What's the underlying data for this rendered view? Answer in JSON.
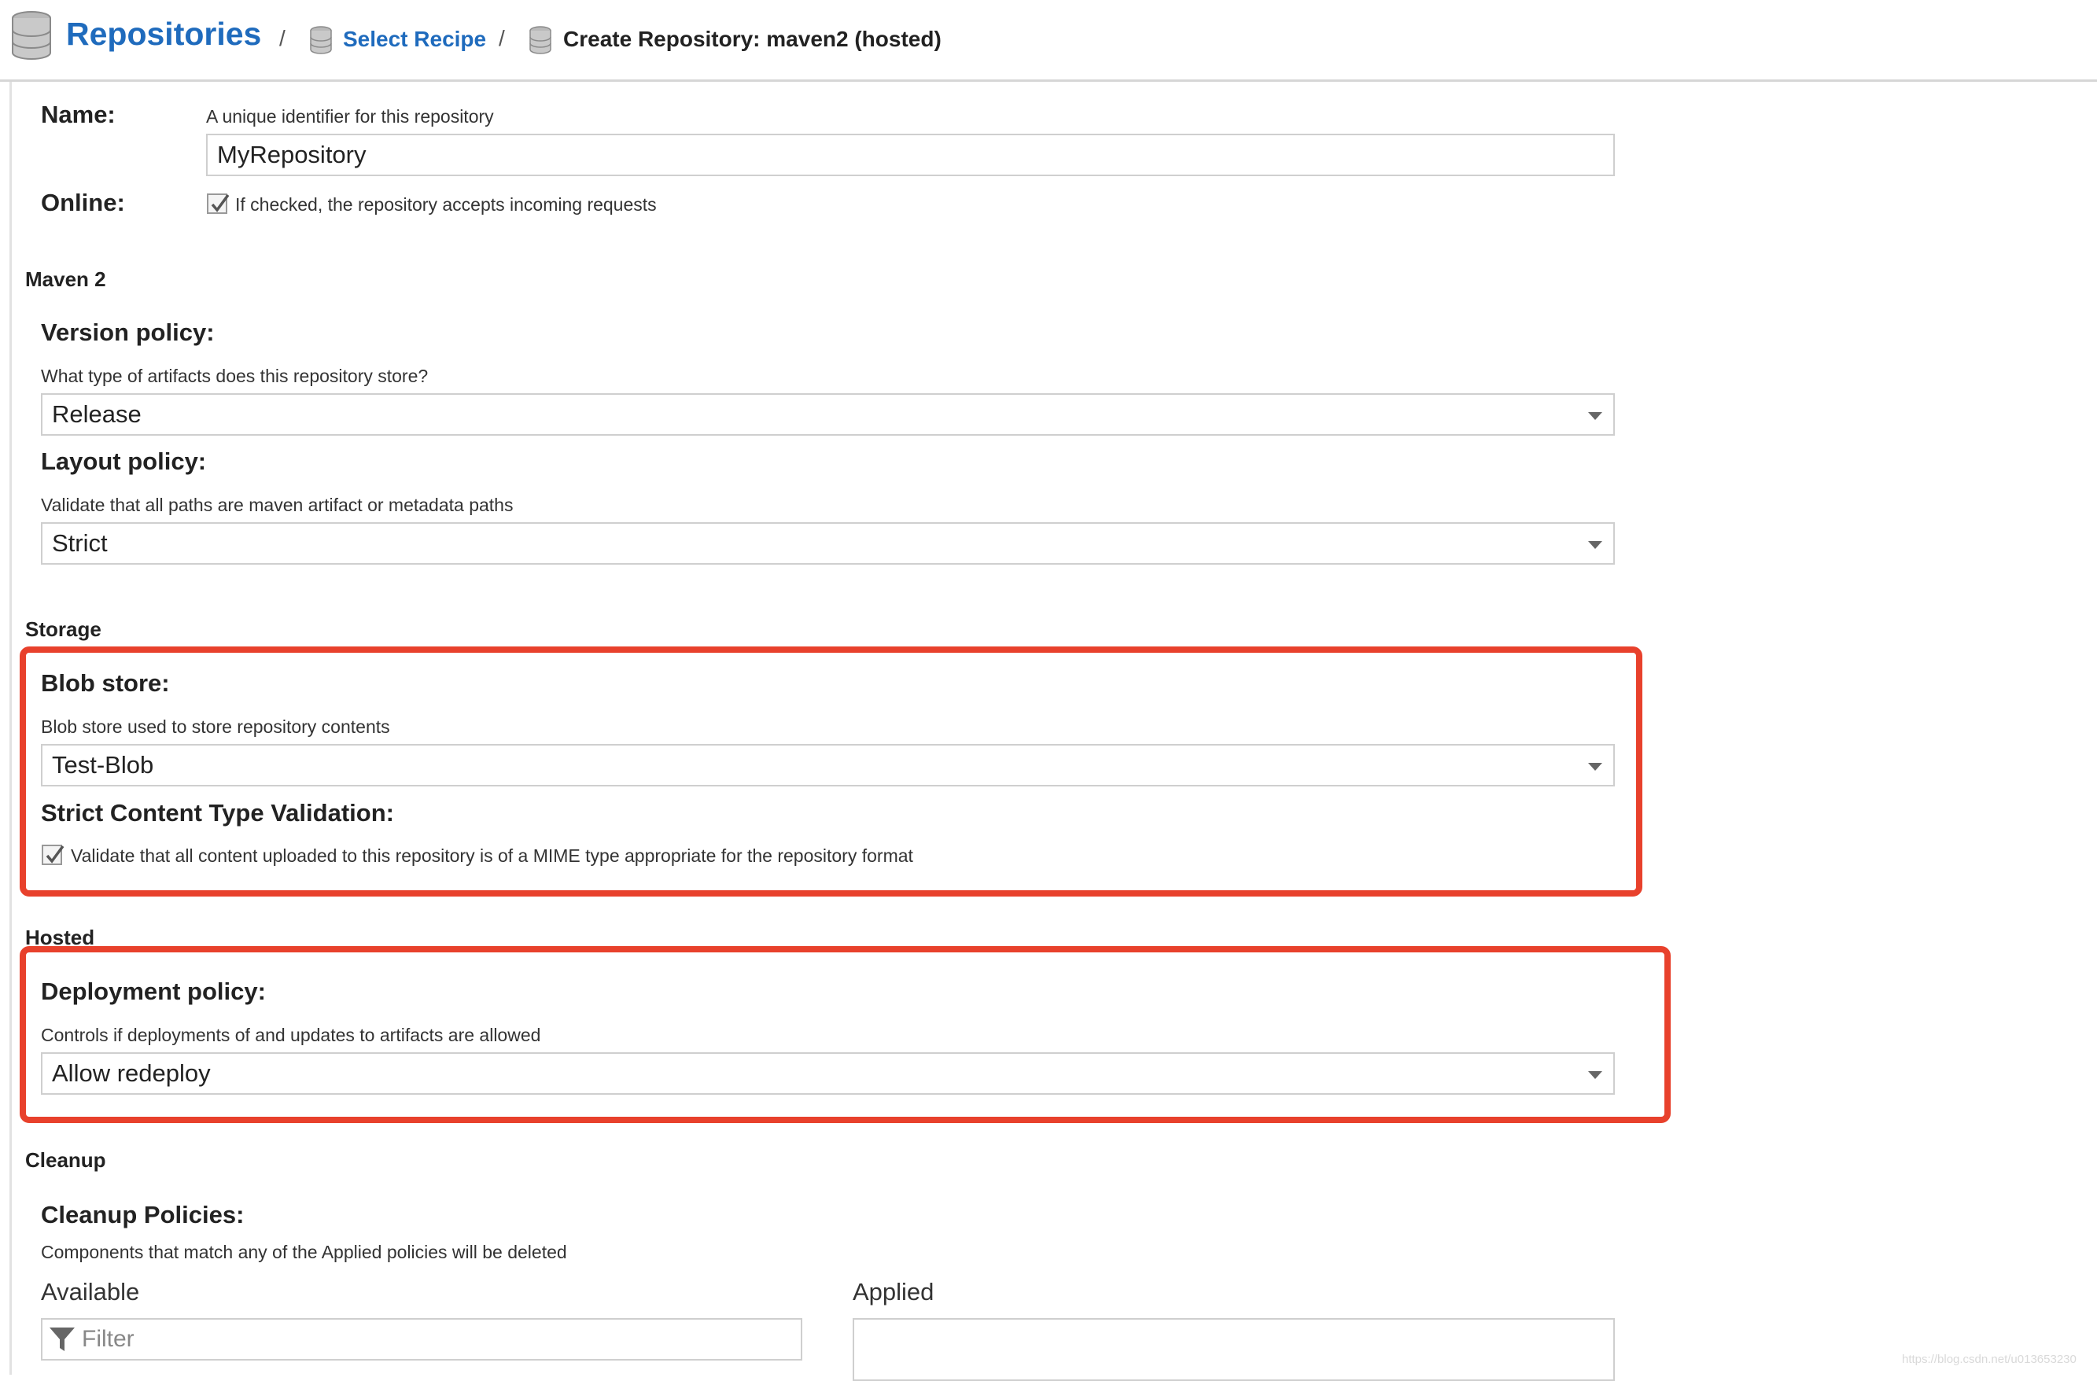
{
  "header": {
    "root_title": "Repositories",
    "separator": "/",
    "crumb_select_recipe": "Select Recipe",
    "crumb_current": "Create Repository: maven2 (hosted)",
    "icon": "database-icon"
  },
  "form": {
    "name": {
      "label": "Name:",
      "help": "A unique identifier for this repository",
      "value": "MyRepository"
    },
    "online": {
      "label": "Online:",
      "checked": true,
      "help": "If checked, the repository accepts incoming requests"
    },
    "maven2": {
      "section": "Maven 2",
      "version_policy": {
        "label": "Version policy:",
        "help": "What type of artifacts does this repository store?",
        "value": "Release"
      },
      "layout_policy": {
        "label": "Layout policy:",
        "help": "Validate that all paths are maven artifact or metadata paths",
        "value": "Strict"
      }
    },
    "storage": {
      "section": "Storage",
      "blob_store": {
        "label": "Blob store:",
        "help": "Blob store used to store repository contents",
        "value": "Test-Blob"
      },
      "strict_content": {
        "label": "Strict Content Type Validation:",
        "checked": true,
        "help": "Validate that all content uploaded to this repository is of a MIME type appropriate for the repository format"
      }
    },
    "hosted": {
      "section": "Hosted",
      "deployment_policy": {
        "label": "Deployment policy:",
        "help": "Controls if deployments of and updates to artifacts are allowed",
        "value": "Allow redeploy"
      }
    },
    "cleanup": {
      "section": "Cleanup",
      "policies": {
        "label": "Cleanup Policies:",
        "help": "Components that match any of the Applied policies will be deleted",
        "available_label": "Available",
        "applied_label": "Applied",
        "filter_placeholder": "Filter"
      }
    }
  },
  "colors": {
    "link": "#1f6bbd",
    "highlight": "#e8412c"
  },
  "watermark": "https://blog.csdn.net/u013653230"
}
